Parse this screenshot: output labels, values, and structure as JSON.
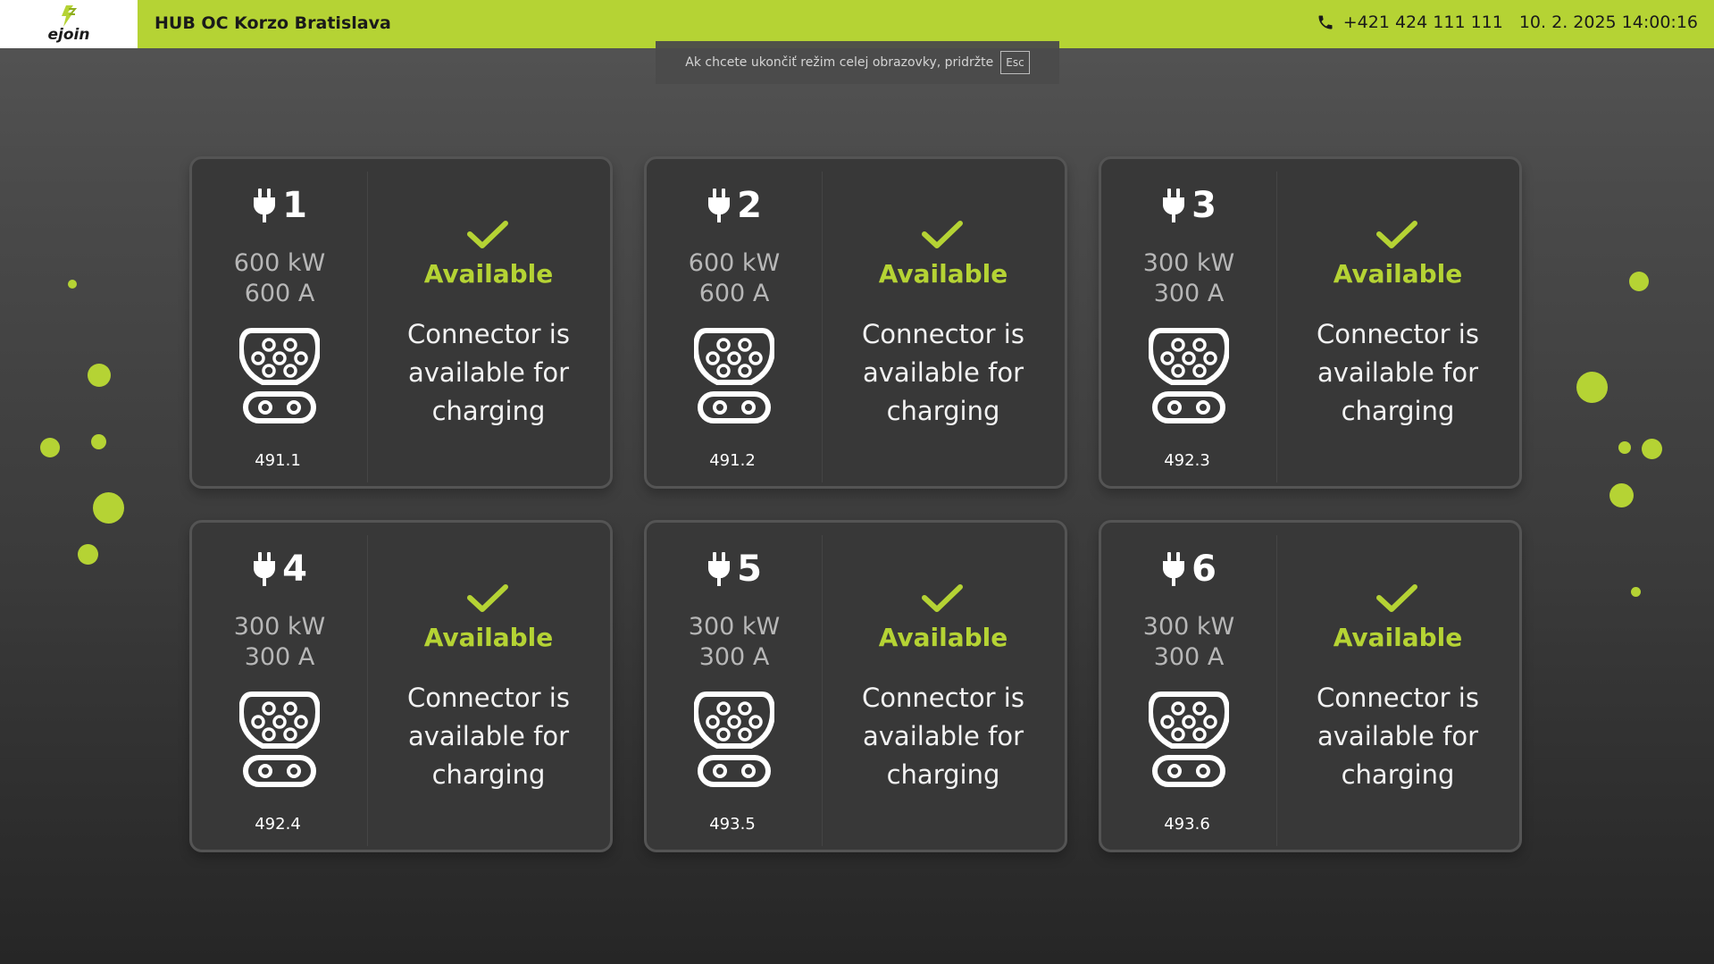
{
  "header": {
    "logo_text": "ejoin",
    "site_title": "HUB OC Korzo Bratislava",
    "phone": "+421 424 111 111",
    "datetime": "10. 2. 2025 14:00:16"
  },
  "fullscreen_notice": {
    "text": "Ak chcete ukončiť režim celej obrazovky, pridržte",
    "key": "Esc"
  },
  "colors": {
    "accent": "#b5d334",
    "card_background": "#383838",
    "page_background": "#3a3a3a"
  },
  "connectors": [
    {
      "number": "1",
      "power": "600 kW",
      "current": "600 A",
      "id": "491.1",
      "status": "Available",
      "description": "Connector is available for charging",
      "plug_icon": "plug-icon",
      "connector_icon": "type2-connector-icon",
      "status_icon": "check-icon"
    },
    {
      "number": "2",
      "power": "600 kW",
      "current": "600 A",
      "id": "491.2",
      "status": "Available",
      "description": "Connector is available for charging",
      "plug_icon": "plug-icon",
      "connector_icon": "type2-connector-icon",
      "status_icon": "check-icon"
    },
    {
      "number": "3",
      "power": "300 kW",
      "current": "300 A",
      "id": "492.3",
      "status": "Available",
      "description": "Connector is available for charging",
      "plug_icon": "plug-icon",
      "connector_icon": "type2-connector-icon",
      "status_icon": "check-icon"
    },
    {
      "number": "4",
      "power": "300 kW",
      "current": "300 A",
      "id": "492.4",
      "status": "Available",
      "description": "Connector is available for charging",
      "plug_icon": "plug-icon",
      "connector_icon": "type2-connector-icon",
      "status_icon": "check-icon"
    },
    {
      "number": "5",
      "power": "300 kW",
      "current": "300 A",
      "id": "493.5",
      "status": "Available",
      "description": "Connector is available for charging",
      "plug_icon": "plug-icon",
      "connector_icon": "type2-connector-icon",
      "status_icon": "check-icon"
    },
    {
      "number": "6",
      "power": "300 kW",
      "current": "300 A",
      "id": "493.6",
      "status": "Available",
      "description": "Connector is available for charging",
      "plug_icon": "plug-icon",
      "connector_icon": "type2-connector-icon",
      "status_icon": "check-icon"
    }
  ]
}
